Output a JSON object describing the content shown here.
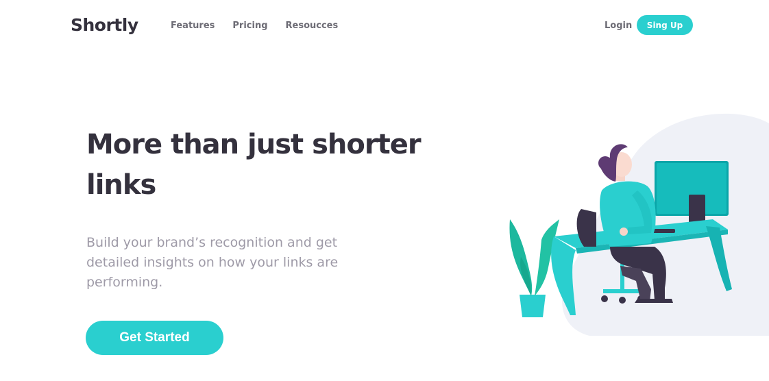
{
  "header": {
    "logo": "Shortly",
    "nav": [
      {
        "label": "Features"
      },
      {
        "label": "Pricing"
      },
      {
        "label": "Resoucces"
      }
    ],
    "login_label": "Login",
    "signup_label": "Sing Up"
  },
  "hero": {
    "title": "More than just shorter links",
    "description": "Build your brand’s recognition and get detailed insights on how your links are performing.",
    "cta_label": "Get Started"
  },
  "colors": {
    "accent": "#2acfcf",
    "heading": "#34313d",
    "body_text": "#9e9aa7",
    "nav_text": "#6d6c75",
    "blob": "#eff1f7"
  }
}
